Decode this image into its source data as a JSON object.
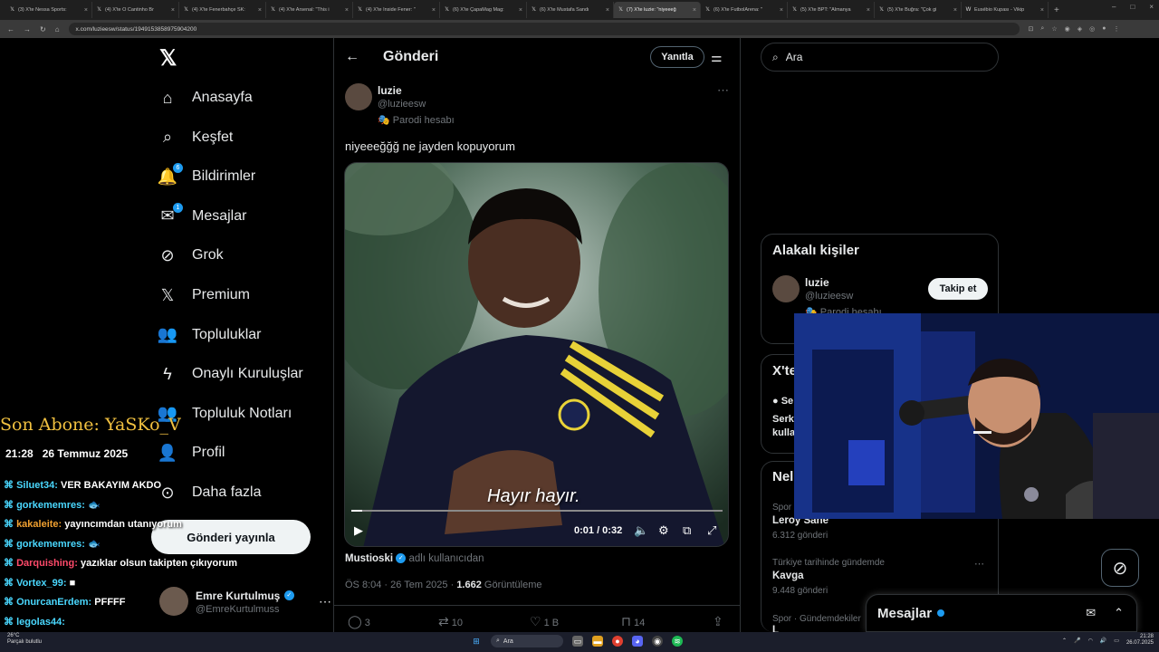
{
  "browser": {
    "tabs": [
      {
        "label": "(3) X'te Nessa Sports:",
        "active": false
      },
      {
        "label": "(4) X'te O Cantinho Br",
        "active": false
      },
      {
        "label": "(4) X'te Fenerbahçe SK:",
        "active": false
      },
      {
        "label": "(4) X'te Arsenal: \"This i",
        "active": false
      },
      {
        "label": "(4) X'te Inside Fener: \"",
        "active": false
      },
      {
        "label": "(6) X'te ÇapaMag Mag:",
        "active": false
      },
      {
        "label": "(6) X'te Mustafa Sandı",
        "active": false
      },
      {
        "label": "(7) X'te luzie: \"niyeeeğ",
        "active": true
      },
      {
        "label": "(6) X'te FutbolArena: \"",
        "active": false
      },
      {
        "label": "(5) X'te BPT: \"Almanya",
        "active": false
      },
      {
        "label": "(5) X'te Buğra: \"Çok gi",
        "active": false
      },
      {
        "label": "Eusébio Kupası - Vikip",
        "active": false
      }
    ],
    "url": "x.com/luzieesw/status/1949153858975904200"
  },
  "nav": {
    "items": [
      {
        "label": "Anasayfa",
        "icon": "home-icon",
        "glyph": "⌂"
      },
      {
        "label": "Keşfet",
        "icon": "search-icon",
        "glyph": "⌕"
      },
      {
        "label": "Bildirimler",
        "icon": "bell-icon",
        "glyph": "🔔",
        "badge": "6"
      },
      {
        "label": "Mesajlar",
        "icon": "mail-icon",
        "glyph": "✉",
        "badge": "1"
      },
      {
        "label": "Grok",
        "icon": "grok-icon",
        "glyph": "⊘"
      },
      {
        "label": "Premium",
        "icon": "x-logo-icon",
        "glyph": "𝕏"
      },
      {
        "label": "Topluluklar",
        "icon": "communities-icon",
        "glyph": "👥"
      },
      {
        "label": "Onaylı Kuruluşlar",
        "icon": "lightning-icon",
        "glyph": "ϟ"
      },
      {
        "label": "Topluluk Notları",
        "icon": "notes-icon",
        "glyph": "👥"
      },
      {
        "label": "Profil",
        "icon": "profile-icon",
        "glyph": "👤"
      },
      {
        "label": "Daha fazla",
        "icon": "more-circle-icon",
        "glyph": "⊙"
      }
    ],
    "post_button": "Gönderi yayınla",
    "account": {
      "name": "Emre Kurtulmuş",
      "handle": "@EmreKurtulmuss"
    }
  },
  "overlay": {
    "sub_line": "Son Abone: YaSKo_V",
    "time": "21:28",
    "date": "26 Temmuz 2025",
    "chat": [
      {
        "user": "Siluet34:",
        "msg": "VER BAKAYIM AKDO",
        "color": "#4ad8ff"
      },
      {
        "user": "gorkememres:",
        "msg": "🐟",
        "color": "#4ad8ff"
      },
      {
        "user": "kakaleite:",
        "msg": "yayıncımdan utanıyorum",
        "color": "#f0a030"
      },
      {
        "user": "gorkememres:",
        "msg": "🐟",
        "color": "#4ad8ff"
      },
      {
        "user": "Darquishing:",
        "msg": "yazıklar olsun takipten çıkıyorum",
        "color": "#ff4a6a"
      },
      {
        "user": "Vortex_99:",
        "msg": "■",
        "color": "#4ad8ff"
      },
      {
        "user": "OnurcanErdem:",
        "msg": "PFFFF",
        "color": "#4ad8ff"
      },
      {
        "user": "legolas44:",
        "msg": "",
        "color": "#4ad8ff"
      }
    ]
  },
  "post": {
    "header_title": "Gönderi",
    "reply_button": "Yanıtla",
    "author_name": "luzie",
    "author_handle": "@luzieesw",
    "parody_label": "Parodi hesabı",
    "text": "niyeeeğğğ ne jayden kopuyorum",
    "video": {
      "subtitle": "Hayır hayır.",
      "time": "0:01 / 0:32",
      "progress": 0.03
    },
    "source_user": "Mustioski",
    "source_suffix": "adlı kullanıcıdan",
    "time": "ÖS 8:04 · 26 Tem 2025 · ",
    "views": "1.662",
    "views_label": "Görüntüleme",
    "replies": "3",
    "reposts": "10",
    "likes": "1 B",
    "bookmarks": "14"
  },
  "right": {
    "search_placeholder": "Ara",
    "related_title": "Alakalı kişiler",
    "related": {
      "name": "luzie",
      "handle": "@luzieesw",
      "parody": "Parodi hesabı",
      "follow": "Takip et"
    },
    "news_title": "X'te",
    "news_source": "Se",
    "news_line1": "Serk",
    "news_line2": "kulla",
    "trends_title": "Nel",
    "trends": [
      {
        "cat": "Spor",
        "name": "Leroy Sané",
        "count": "6.312 gönderi"
      },
      {
        "cat": "Türkiye tarihinde gündemde",
        "name": "Kavga",
        "count": "9.448 gönderi"
      },
      {
        "cat": "Spor · Gündemdekiler",
        "name": "L",
        "count": ""
      }
    ],
    "messages_title": "Mesajlar"
  },
  "taskbar": {
    "weather_temp": "26°C",
    "weather_desc": "Parçalı bulutlu",
    "search": "Ara",
    "time": "21:28",
    "date": "26.07.2025"
  }
}
